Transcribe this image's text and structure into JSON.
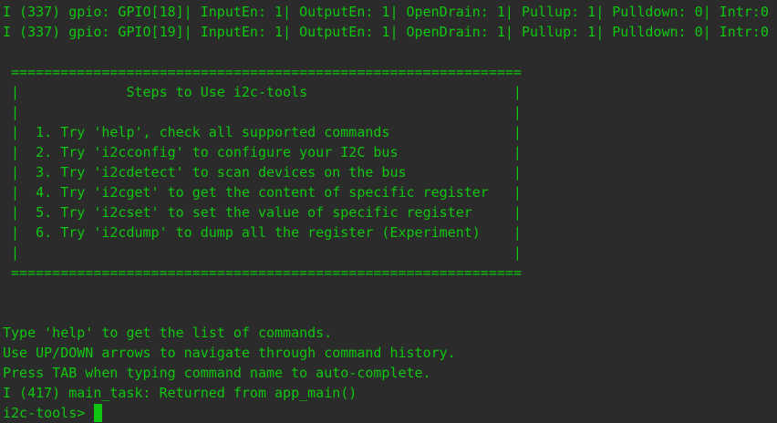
{
  "terminal": {
    "lines": [
      "I (337) gpio: GPIO[18]| InputEn: 1| OutputEn: 1| OpenDrain: 1| Pullup: 1| Pulldown: 0| Intr:0",
      "I (337) gpio: GPIO[19]| InputEn: 1| OutputEn: 1| OpenDrain: 1| Pullup: 1| Pulldown: 0| Intr:0",
      "",
      " ==============================================================",
      " |             Steps to Use i2c-tools                         |",
      " |                                                            |",
      " |  1. Try 'help', check all supported commands               |",
      " |  2. Try 'i2cconfig' to configure your I2C bus              |",
      " |  3. Try 'i2cdetect' to scan devices on the bus             |",
      " |  4. Try 'i2cget' to get the content of specific register   |",
      " |  5. Try 'i2cset' to set the value of specific register     |",
      " |  6. Try 'i2cdump' to dump all the register (Experiment)    |",
      " |                                                            |",
      " ==============================================================",
      "",
      "",
      "Type 'help' to get the list of commands.",
      "Use UP/DOWN arrows to navigate through command history.",
      "Press TAB when typing command name to auto-complete.",
      "I (417) main_task: Returned from app_main()"
    ],
    "prompt": "i2c-tools> ",
    "text_color": "#11c611",
    "background_color": "#2b2b2b"
  }
}
